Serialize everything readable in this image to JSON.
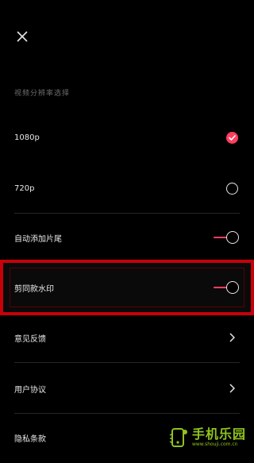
{
  "header": {
    "close_icon": "close-icon"
  },
  "section": {
    "label": "视频分辨率选择"
  },
  "resolution": {
    "options": [
      {
        "label": "1080p",
        "selected": true
      },
      {
        "label": "720p",
        "selected": false
      }
    ]
  },
  "settings": {
    "auto_append_ending": {
      "label": "自动添加片尾",
      "enabled": true
    },
    "capcut_watermark": {
      "label": "剪同款水印",
      "enabled": true
    }
  },
  "links": {
    "feedback": "意见反馈",
    "user_agreement": "用户协议",
    "privacy_terms": "隐私条款"
  },
  "watermark": {
    "title": "手机乐园",
    "url": "www.shouji.com.cn"
  },
  "colors": {
    "accent": "#ff3e5f",
    "highlight_border": "#c8000a",
    "watermark_green": "#8fc31f"
  }
}
